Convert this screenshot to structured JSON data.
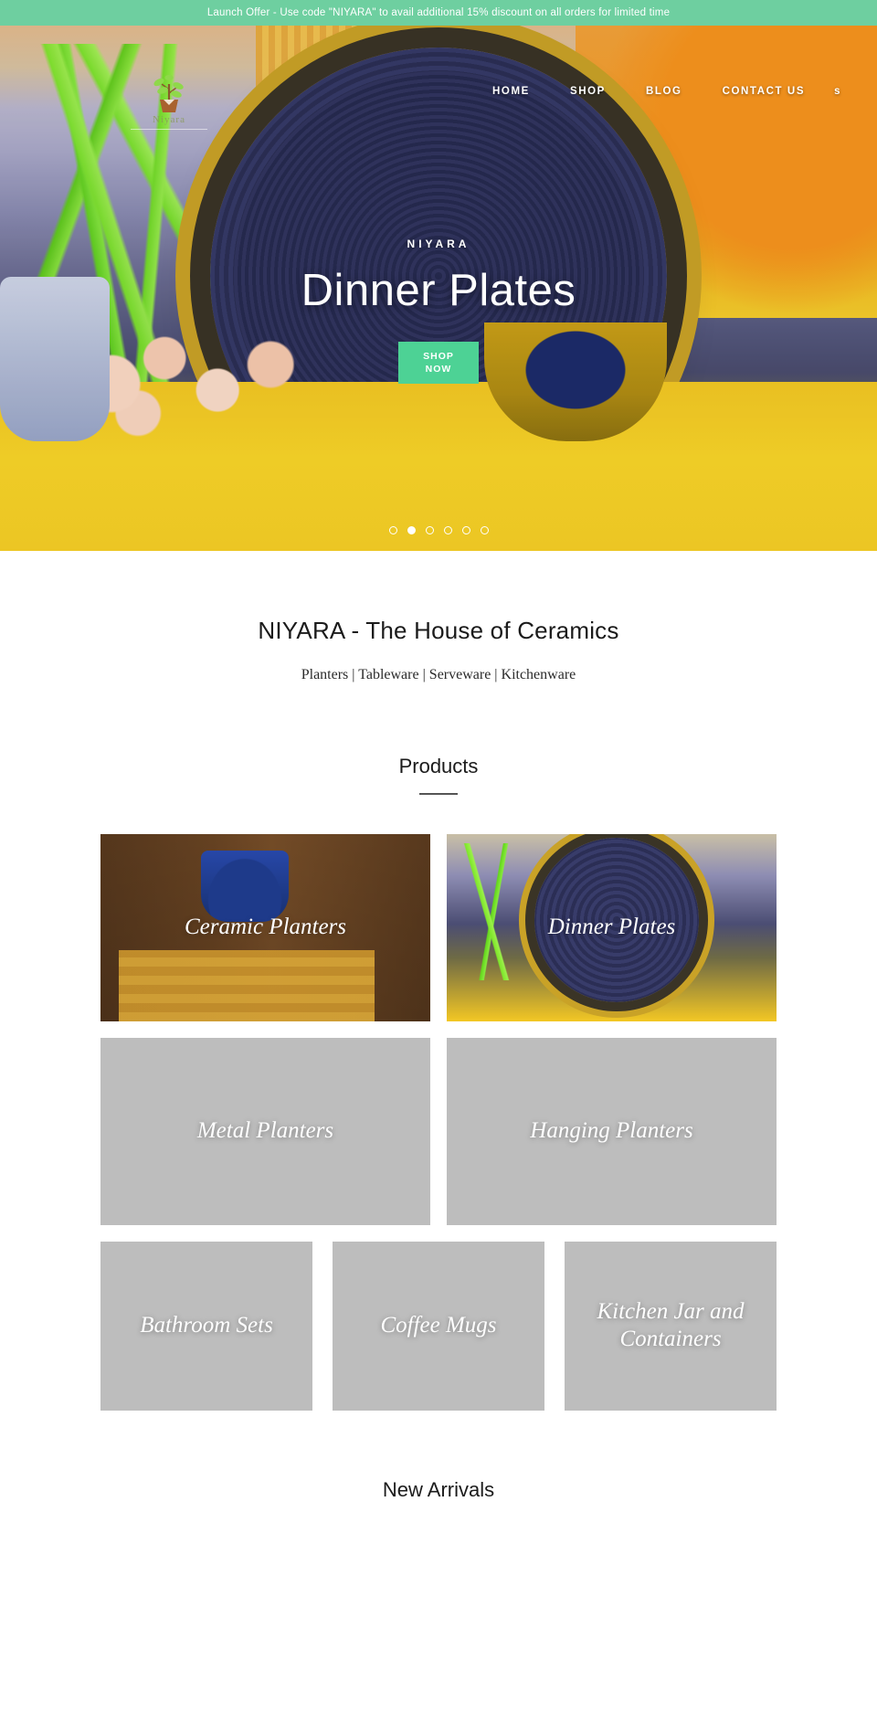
{
  "announcement": {
    "text": "Launch Offer - Use code \"NIYARA\" to avail additional 15% discount on all orders for limited time"
  },
  "header": {
    "logo_name": "Niyara",
    "logo_icon": "seedling-in-pot-icon",
    "nav": [
      {
        "label": "HOME"
      },
      {
        "label": "SHOP"
      },
      {
        "label": "BLOG"
      },
      {
        "label": "CONTACT US"
      },
      {
        "label": "s"
      }
    ]
  },
  "hero": {
    "eyebrow": "NIYARA",
    "title": "Dinner Plates",
    "cta_line1": "SHOP",
    "cta_line2": "NOW",
    "slides_total": 6,
    "active_slide": 2
  },
  "intro": {
    "title": "NIYARA - The House of Ceramics",
    "subtitle": "Planters | Tableware | Serveware | Kitchenware"
  },
  "products": {
    "section_title": "Products",
    "tiles": [
      {
        "label": "Ceramic Planters"
      },
      {
        "label": "Dinner Plates"
      },
      {
        "label": "Metal Planters"
      },
      {
        "label": "Hanging Planters"
      },
      {
        "label": "Bathroom Sets"
      },
      {
        "label": "Coffee Mugs"
      },
      {
        "label": "Kitchen Jar and Containers"
      }
    ]
  },
  "new_arrivals": {
    "section_title": "New Arrivals"
  },
  "colors": {
    "announcement_bg": "#6ecfa0",
    "cta_bg": "#4dd295",
    "tile_placeholder": "#bdbdbd",
    "text_dark": "#1b1b1b"
  }
}
